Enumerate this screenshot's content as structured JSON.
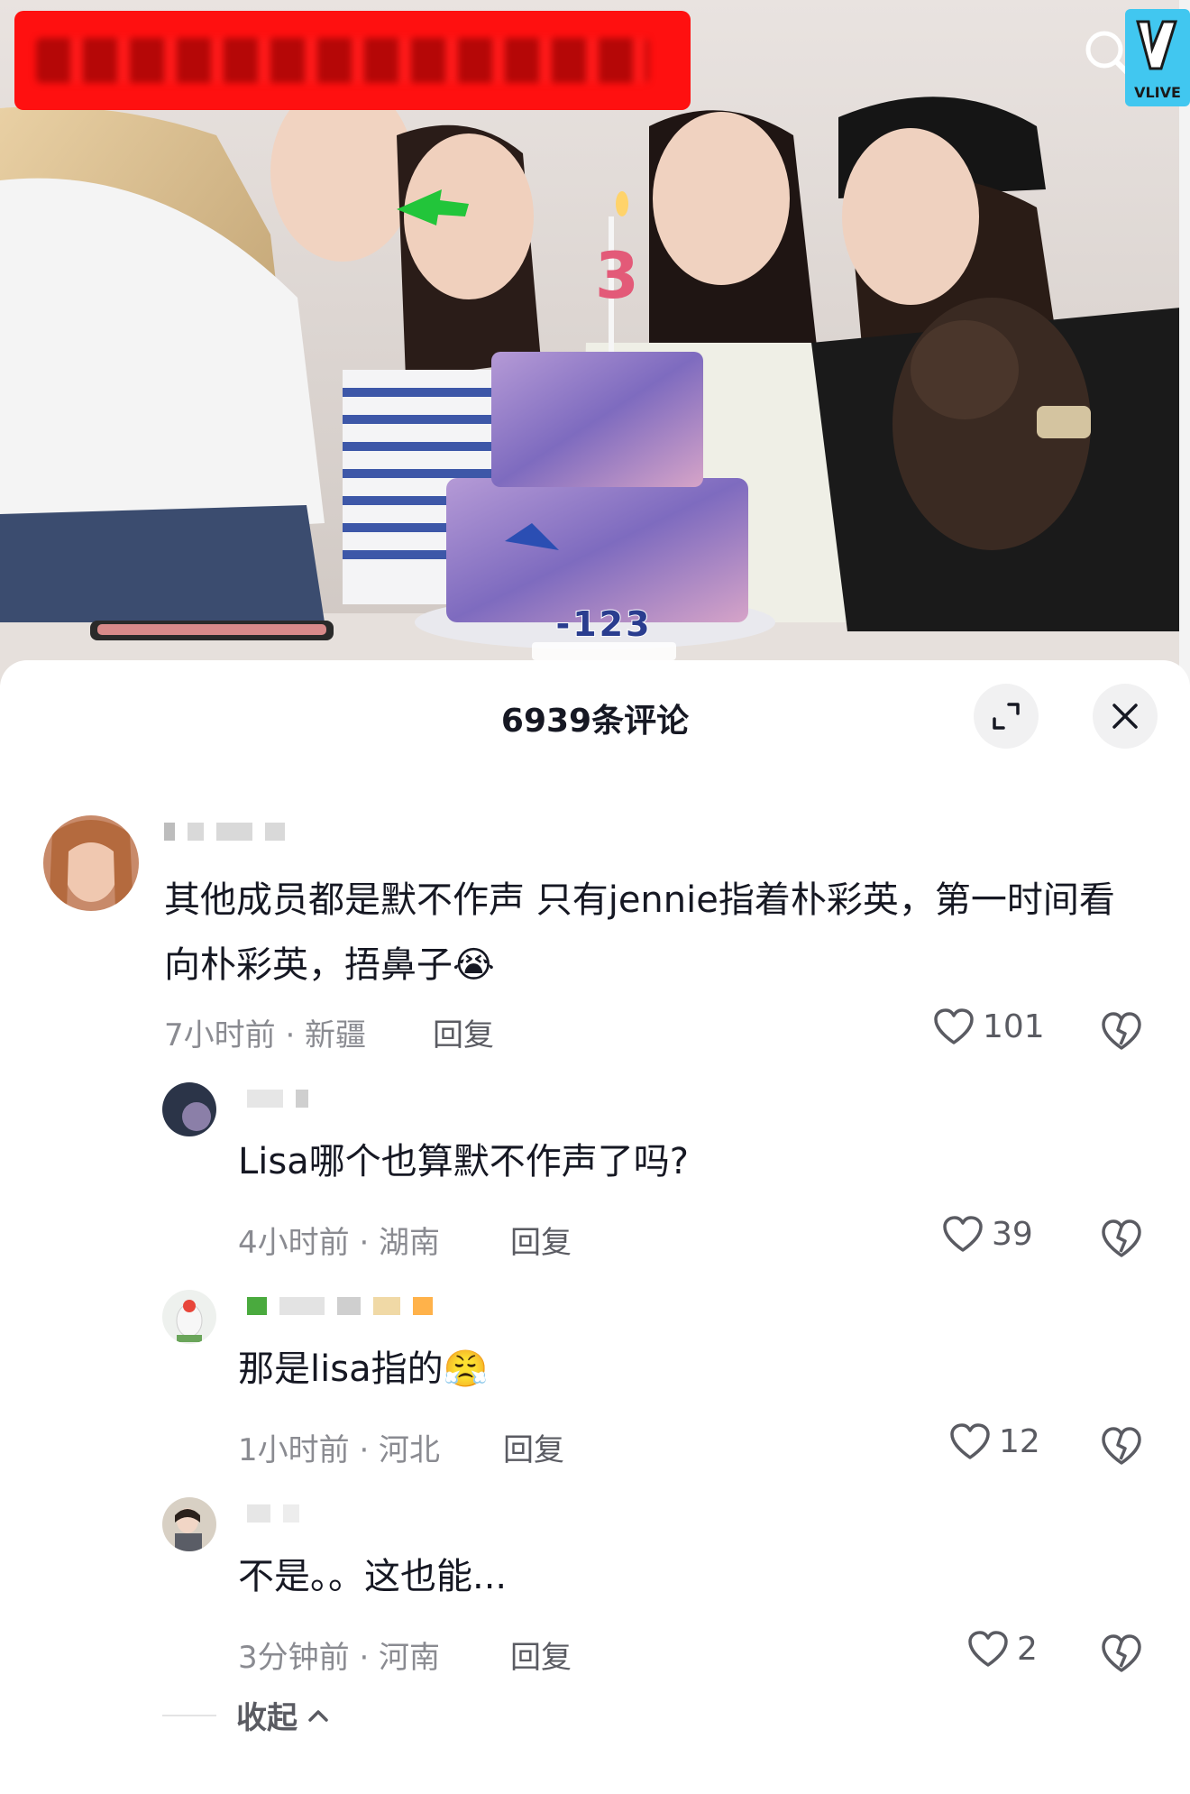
{
  "video": {
    "subtitle_line1": "-123",
    "icons": {
      "search": "search-icon",
      "vlive": "vlive-logo"
    }
  },
  "header": {
    "title": "6939条评论",
    "expand_icon": "expand-icon",
    "close_icon": "close-icon"
  },
  "comments": [
    {
      "text": "其他成员都是默不作声 只有jennie指着朴彩英，第一时间看向朴彩英，捂鼻子😭",
      "meta": "7小时前 · 新疆",
      "reply": "回复",
      "likes": "101"
    },
    {
      "text": "Lisa哪个也算默不作声了吗?",
      "meta": "4小时前 · 湖南",
      "reply": "回复",
      "likes": "39"
    },
    {
      "text": "那是lisa指的😤",
      "meta": "1小时前 · 河北",
      "reply": "回复",
      "likes": "12"
    },
    {
      "text": "不是。。这也能...",
      "meta": "3分钟前 · 河南",
      "reply": "回复",
      "likes": "2"
    }
  ],
  "footer": {
    "collapse_label": "收起",
    "collapse_icon": "chevron-up-icon"
  },
  "colors": {
    "banner": "#ff1010",
    "text_primary": "#161823",
    "text_secondary": "#8a8b91"
  }
}
